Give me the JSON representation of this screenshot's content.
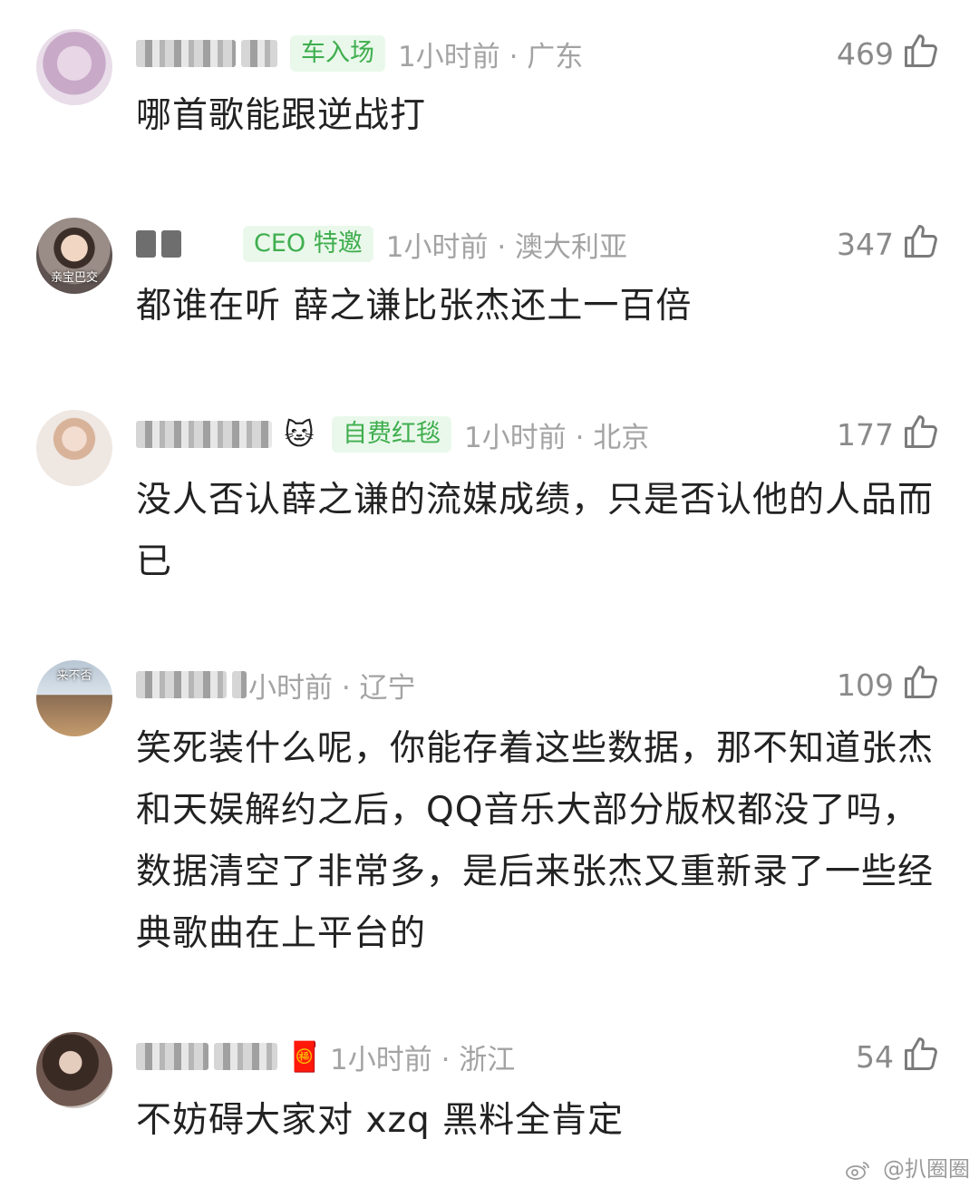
{
  "comments": [
    {
      "badge": "车入场",
      "meta": "1小时前 · 广东",
      "likes": "469",
      "text": "哪首歌能跟逆战打",
      "avatar_caption": "",
      "badge_icon": ""
    },
    {
      "badge": "CEO 特邀",
      "meta": "1小时前 · 澳大利亚",
      "likes": "347",
      "text": "都谁在听 薛之谦比张杰还土一百倍",
      "avatar_caption": "亲宝巴交",
      "badge_icon": ""
    },
    {
      "badge": "自费红毯",
      "meta": "1小时前 · 北京",
      "likes": "177",
      "text": "没人否认薛之谦的流媒成绩，只是否认他的人品而已",
      "avatar_caption": "",
      "badge_icon": "🐱"
    },
    {
      "badge": "",
      "meta": "小时前 · 辽宁",
      "likes": "109",
      "text": "笑死装什么呢，你能存着这些数据，那不知道张杰和天娱解约之后，QQ音乐大部分版权都没了吗，数据清空了非常多，是后来张杰又重新录了一些经典歌曲在上平台的",
      "avatar_caption": "来不否",
      "badge_icon": ""
    },
    {
      "badge": "",
      "meta": "1小时前 · 浙江",
      "likes": "54",
      "text": "不妨碍大家对 xzq 黑料全肯定",
      "avatar_caption": "",
      "badge_icon": "🧧"
    }
  ],
  "footer": {
    "watermark": "@扒圈圈"
  },
  "colors": {
    "badge_bg": "#e9f8ea",
    "badge_text": "#3fae4f",
    "meta_text": "#a3a3a3"
  }
}
